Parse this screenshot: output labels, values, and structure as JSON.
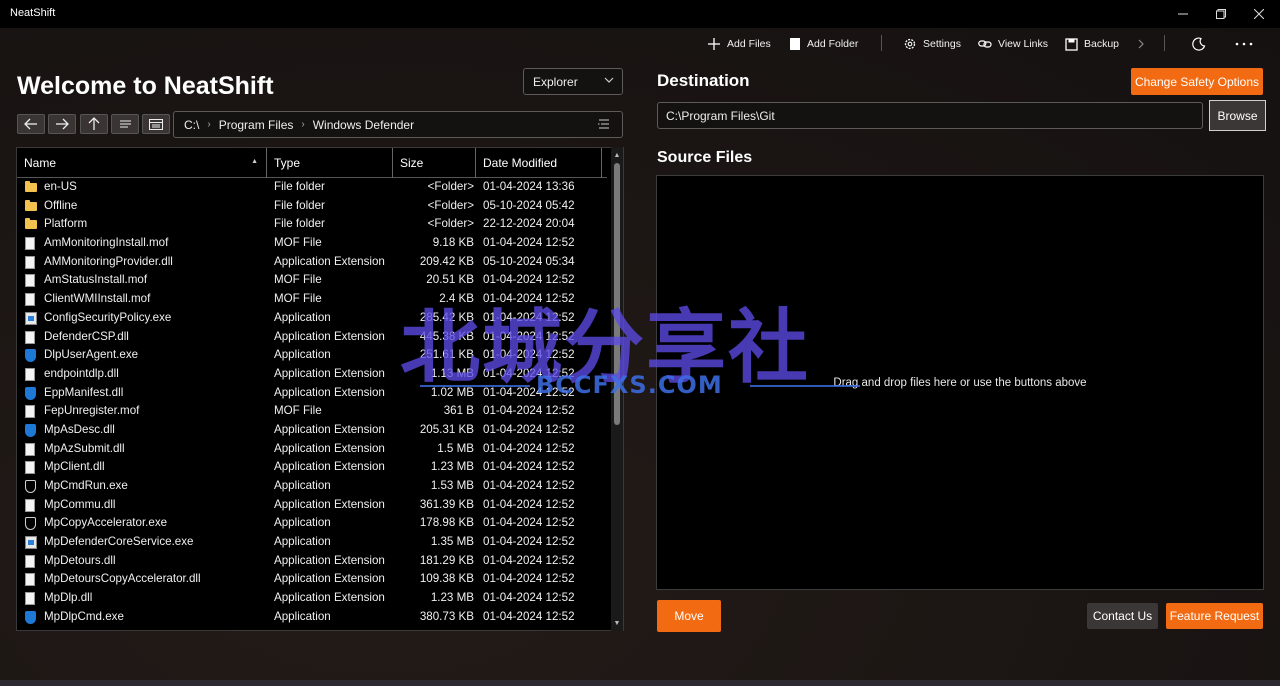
{
  "window": {
    "title": "NeatShift"
  },
  "commands": {
    "add_files": "Add Files",
    "add_folder": "Add Folder",
    "settings": "Settings",
    "view_links": "View Links",
    "backup": "Backup"
  },
  "left": {
    "welcome": "Welcome to NeatShift",
    "view_select": "Explorer",
    "breadcrumb": [
      "C:\\",
      "Program Files",
      "Windows Defender"
    ],
    "columns": [
      "Name",
      "Type",
      "Size",
      "Date Modified"
    ],
    "files": [
      {
        "icon": "folder-icon",
        "name": "en-US",
        "type": "File folder",
        "size": "<Folder>",
        "date": "01-04-2024 13:36"
      },
      {
        "icon": "folder-icon",
        "name": "Offline",
        "type": "File folder",
        "size": "<Folder>",
        "date": "05-10-2024 05:42"
      },
      {
        "icon": "folder-icon",
        "name": "Platform",
        "type": "File folder",
        "size": "<Folder>",
        "date": "22-12-2024 20:04"
      },
      {
        "icon": "file-icon",
        "name": "AmMonitoringInstall.mof",
        "type": "MOF File",
        "size": "9.18 KB",
        "date": "01-04-2024 12:52"
      },
      {
        "icon": "dll-icon",
        "name": "AMMonitoringProvider.dll",
        "type": "Application Extension",
        "size": "209.42 KB",
        "date": "05-10-2024 05:34"
      },
      {
        "icon": "file-icon",
        "name": "AmStatusInstall.mof",
        "type": "MOF File",
        "size": "20.51 KB",
        "date": "01-04-2024 12:52"
      },
      {
        "icon": "file-icon",
        "name": "ClientWMIInstall.mof",
        "type": "MOF File",
        "size": "2.4 KB",
        "date": "01-04-2024 12:52"
      },
      {
        "icon": "exe-icon",
        "name": "ConfigSecurityPolicy.exe",
        "type": "Application",
        "size": "285.42 KB",
        "date": "01-04-2024 12:52"
      },
      {
        "icon": "dll-icon",
        "name": "DefenderCSP.dll",
        "type": "Application Extension",
        "size": "445.38 KB",
        "date": "01-04-2024 12:52"
      },
      {
        "icon": "shield-icon",
        "name": "DlpUserAgent.exe",
        "type": "Application",
        "size": "251.61 KB",
        "date": "01-04-2024 12:52"
      },
      {
        "icon": "dll-icon",
        "name": "endpointdlp.dll",
        "type": "Application Extension",
        "size": "1.13 MB",
        "date": "01-04-2024 12:52"
      },
      {
        "icon": "shield-icon",
        "name": "EppManifest.dll",
        "type": "Application Extension",
        "size": "1.02 MB",
        "date": "01-04-2024 12:52"
      },
      {
        "icon": "file-icon",
        "name": "FepUnregister.mof",
        "type": "MOF File",
        "size": "361 B",
        "date": "01-04-2024 12:52"
      },
      {
        "icon": "shield-icon",
        "name": "MpAsDesc.dll",
        "type": "Application Extension",
        "size": "205.31 KB",
        "date": "01-04-2024 12:52"
      },
      {
        "icon": "dll-icon",
        "name": "MpAzSubmit.dll",
        "type": "Application Extension",
        "size": "1.5 MB",
        "date": "01-04-2024 12:52"
      },
      {
        "icon": "dll-icon",
        "name": "MpClient.dll",
        "type": "Application Extension",
        "size": "1.23 MB",
        "date": "01-04-2024 12:52"
      },
      {
        "icon": "shield-outline-icon",
        "name": "MpCmdRun.exe",
        "type": "Application",
        "size": "1.53 MB",
        "date": "01-04-2024 12:52"
      },
      {
        "icon": "dll-icon",
        "name": "MpCommu.dll",
        "type": "Application Extension",
        "size": "361.39 KB",
        "date": "01-04-2024 12:52"
      },
      {
        "icon": "shield-outline-icon",
        "name": "MpCopyAccelerator.exe",
        "type": "Application",
        "size": "178.98 KB",
        "date": "01-04-2024 12:52"
      },
      {
        "icon": "exe-icon",
        "name": "MpDefenderCoreService.exe",
        "type": "Application",
        "size": "1.35 MB",
        "date": "01-04-2024 12:52"
      },
      {
        "icon": "dll-icon",
        "name": "MpDetours.dll",
        "type": "Application Extension",
        "size": "181.29 KB",
        "date": "01-04-2024 12:52"
      },
      {
        "icon": "dll-icon",
        "name": "MpDetoursCopyAccelerator.dll",
        "type": "Application Extension",
        "size": "109.38 KB",
        "date": "01-04-2024 12:52"
      },
      {
        "icon": "dll-icon",
        "name": "MpDlp.dll",
        "type": "Application Extension",
        "size": "1.23 MB",
        "date": "01-04-2024 12:52"
      },
      {
        "icon": "shield-icon",
        "name": "MpDlpCmd.exe",
        "type": "Application",
        "size": "380.73 KB",
        "date": "01-04-2024 12:52"
      }
    ]
  },
  "right": {
    "destination_title": "Destination",
    "change_safety": "Change Safety Options",
    "destination_path": "C:\\Program Files\\Git",
    "browse": "Browse",
    "source_title": "Source Files",
    "drop_hint": "Drag and drop files here or use the buttons above",
    "move": "Move",
    "contact": "Contact Us",
    "feature": "Feature Request"
  },
  "watermark": {
    "cn": "北城分享社",
    "en": "BCCFXS.COM"
  },
  "colors": {
    "accent": "#f26b12",
    "background": "#1c1716",
    "panel": "#000000"
  }
}
